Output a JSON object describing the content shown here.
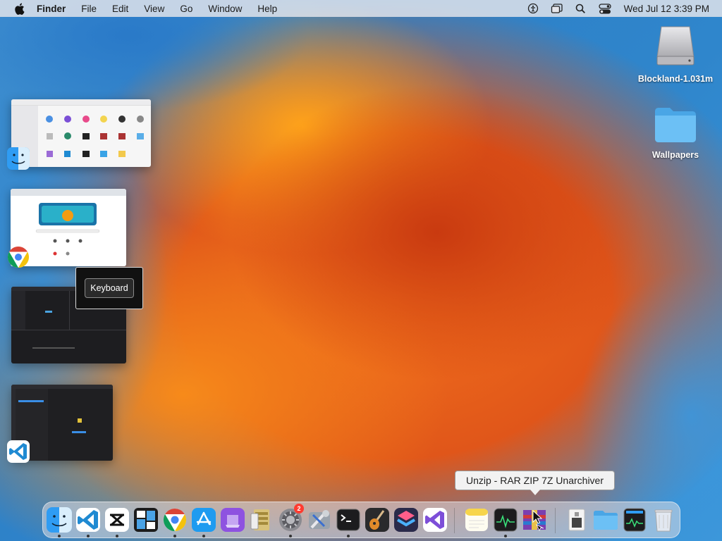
{
  "menubar": {
    "app_name": "Finder",
    "items": [
      "File",
      "Edit",
      "View",
      "Go",
      "Window",
      "Help"
    ],
    "clock": "Wed Jul 12  3:39 PM",
    "status_icons": [
      "accessibility-icon",
      "window-switcher-icon",
      "spotlight-icon",
      "control-center-icon"
    ]
  },
  "desktop_icons": [
    {
      "label": "Blockland-1.031m",
      "icon": "drive-icon"
    },
    {
      "label": "Wallpapers",
      "icon": "folder-icon"
    }
  ],
  "expose": {
    "windows": [
      {
        "app": "Finder",
        "icon": "finder-icon"
      },
      {
        "app": "Google Chrome",
        "icon": "chrome-icon"
      },
      {
        "app": "Terminal-like editor",
        "icon": ""
      },
      {
        "app": "Visual Studio Code",
        "icon": "vscode-icon"
      }
    ],
    "keyboard_label": "Keyboard"
  },
  "tooltip": {
    "text": "Unzip - RAR ZIP 7Z Unarchiver"
  },
  "dock": {
    "apps": [
      {
        "name": "Finder",
        "icon": "finder-icon",
        "running": true
      },
      {
        "name": "Visual Studio Code",
        "icon": "vscode-icon",
        "running": true
      },
      {
        "name": "CapCut",
        "icon": "capcut-icon",
        "running": true
      },
      {
        "name": "Mission Control",
        "icon": "mission-control-icon",
        "running": false
      },
      {
        "name": "Google Chrome",
        "icon": "chrome-icon",
        "running": true
      },
      {
        "name": "App Store",
        "icon": "app-store-icon",
        "running": true
      },
      {
        "name": "Notion-like",
        "icon": "purple-app-icon",
        "running": false
      },
      {
        "name": "Archive Utility",
        "icon": "archive-icon",
        "running": false
      },
      {
        "name": "System Settings",
        "icon": "gear-icon",
        "running": true,
        "badge": "2"
      },
      {
        "name": "Xcode Tools",
        "icon": "tools-icon",
        "running": false
      },
      {
        "name": "Terminal",
        "icon": "terminal-icon",
        "running": true
      },
      {
        "name": "GarageBand",
        "icon": "guitar-icon",
        "running": false
      },
      {
        "name": "Shortcuts",
        "icon": "shortcuts-icon",
        "running": false
      },
      {
        "name": "Visual Studio",
        "icon": "visual-studio-icon",
        "running": false
      },
      {
        "name": "Notes",
        "icon": "notes-icon",
        "running": false
      },
      {
        "name": "Activity Monitor",
        "icon": "activity-monitor-icon",
        "running": true
      },
      {
        "name": "Unzip - RAR ZIP 7Z Unarchiver",
        "icon": "unarchiver-icon",
        "running": false
      },
      {
        "name": "Preview",
        "icon": "preview-icon",
        "running": false
      },
      {
        "name": "Folder",
        "icon": "folder-icon",
        "running": false
      },
      {
        "name": "Activity Monitor 2",
        "icon": "monitor-icon",
        "running": false
      },
      {
        "name": "Trash",
        "icon": "trash-icon",
        "running": false
      }
    ]
  }
}
